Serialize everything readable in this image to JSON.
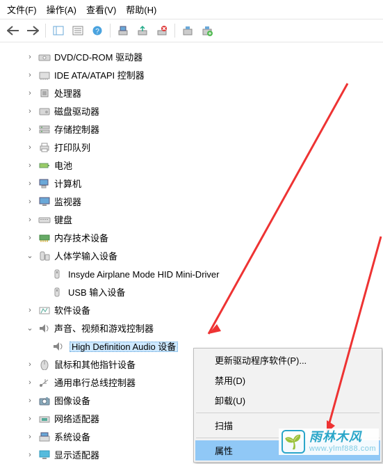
{
  "menu": {
    "file": "文件(F)",
    "action": "操作(A)",
    "view": "查看(V)",
    "help": "帮助(H)"
  },
  "toolbar_icons": {
    "back": "←",
    "fwd": "→",
    "props": "☰",
    "help": "?",
    "refresh": "↻",
    "upd": "⬆",
    "remove": "✖",
    "scan": "🔍"
  },
  "tree": {
    "dvd": "DVD/CD-ROM 驱动器",
    "ide": "IDE ATA/ATAPI 控制器",
    "cpu": "处理器",
    "disk": "磁盘驱动器",
    "storage": "存储控制器",
    "printq": "打印队列",
    "battery": "电池",
    "computer": "计算机",
    "monitor": "监视器",
    "keyboard": "键盘",
    "memtech": "内存技术设备",
    "hid": "人体学输入设备",
    "hid_airplane": "Insyde Airplane Mode HID Mini-Driver",
    "hid_usb": "USB 输入设备",
    "softdev": "软件设备",
    "sound": "声音、视频和游戏控制器",
    "sound_hda": "High Definition Audio 设备",
    "mouse": "鼠标和其他指针设备",
    "usb": "通用串行总线控制器",
    "imaging": "图像设备",
    "net": "网络适配器",
    "sysdev": "系统设备",
    "display": "显示适配器"
  },
  "chevron": {
    "collapsed": "›",
    "expanded": "⌄"
  },
  "context": {
    "update": "更新驱动程序软件(P)...",
    "disable": "禁用(D)",
    "uninstall": "卸载(U)",
    "scan_partial": "扫描",
    "props": "属性"
  },
  "watermark": {
    "emoji": "🌱",
    "title": "雨林木风",
    "url": "www.ylmf888.com"
  }
}
